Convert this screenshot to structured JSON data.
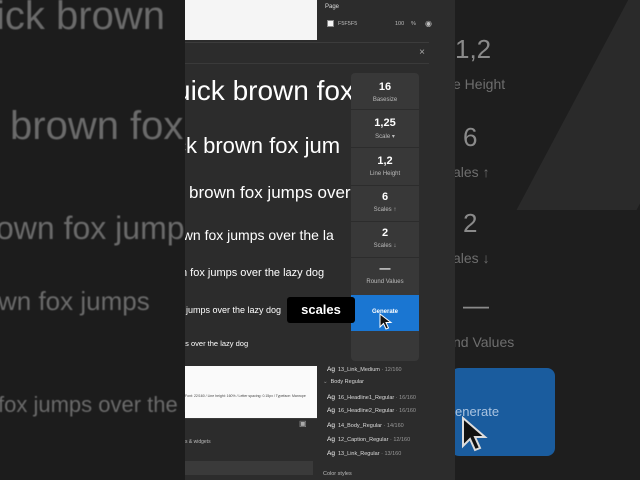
{
  "background_left": {
    "ghost_lines": [
      "ick brown",
      "brown fox",
      "own fox jumps",
      "wn fox jumps",
      "fox jumps over the la"
    ]
  },
  "background_right": {
    "values": [
      "1,2",
      "6",
      "2",
      "—"
    ],
    "labels": [
      "e Height",
      "ales ↑",
      "ales ↓",
      "nd Values"
    ],
    "generate_label": "enerate"
  },
  "page_panel": {
    "title": "Page",
    "color_hex": "F5F5F5",
    "opacity": "100",
    "percent_sign": "%"
  },
  "plugin": {
    "close_icon": "×",
    "samples": [
      "uick brown fox",
      "ck brown fox jum",
      "brown fox jumps over",
      "own fox jumps over the la",
      "n fox jumps over the lazy dog",
      "x jumps over the lazy dog",
      "ps over the lazy dog"
    ],
    "controls": [
      {
        "value": "16",
        "label": "Basesize"
      },
      {
        "value": "1,25",
        "label": "Scale ▾"
      },
      {
        "value": "1,2",
        "label": "Line Height"
      },
      {
        "value": "6",
        "label": "Scales ↑"
      },
      {
        "value": "2",
        "label": "Scales ↓"
      },
      {
        "value": "—",
        "label": "Round Values"
      }
    ],
    "generate_label": "Generate"
  },
  "overlay_badge": "scales",
  "doc_caption": "Font: 22/160 / Line height: 160% / Letter spacing: 0.15px / Typeface: Manrope",
  "left_bottom": {
    "label": "s & widgets",
    "icon": "image-icon"
  },
  "styles": {
    "top_item": {
      "ag": "Ag",
      "name": "13_Link_Medium",
      "meta": "· 12/160"
    },
    "group_title": "Body Regular",
    "items": [
      {
        "ag": "Ag",
        "name": "16_Headline1_Regular",
        "meta": "· 16/160"
      },
      {
        "ag": "Ag",
        "name": "16_Headline2_Regular",
        "meta": "· 16/160"
      },
      {
        "ag": "Ag",
        "name": "14_Body_Regular",
        "meta": "· 14/160"
      },
      {
        "ag": "Ag",
        "name": "12_Caption_Regular",
        "meta": "· 12/160"
      },
      {
        "ag": "Ag",
        "name": "13_Link_Regular",
        "meta": "· 13/160"
      }
    ],
    "color_styles_label": "Color styles"
  },
  "colors": {
    "accent": "#1A76D2",
    "panel": "#2C2C2C",
    "control_bg": "#383838"
  }
}
